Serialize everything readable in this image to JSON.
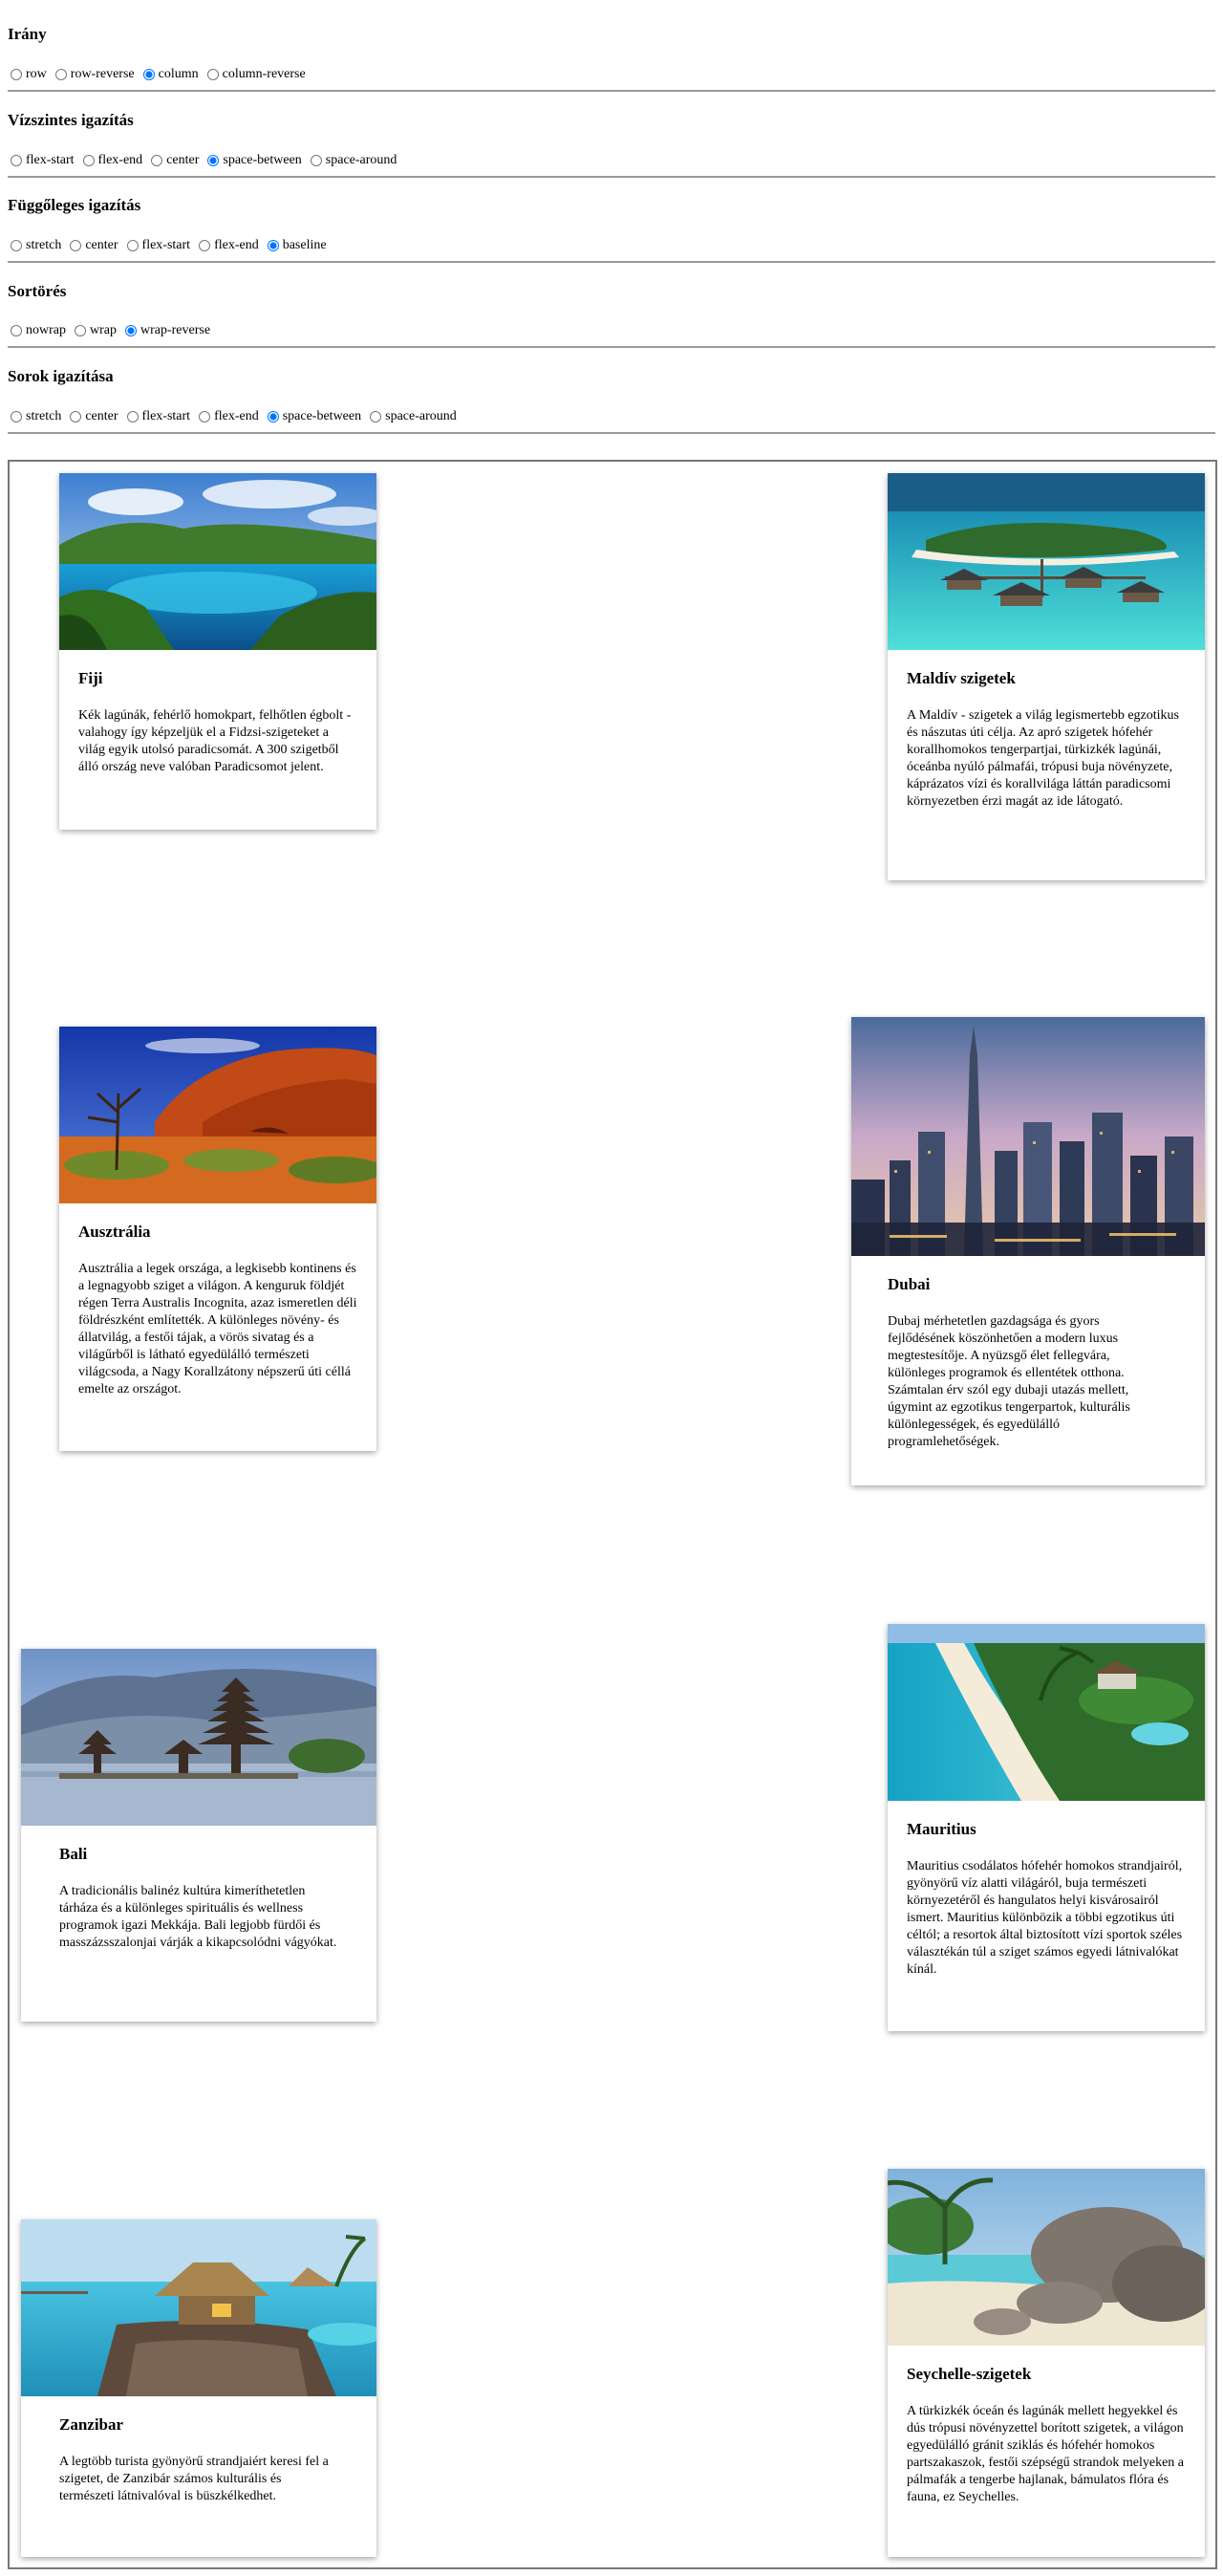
{
  "controls": {
    "direction": {
      "title": "Irány",
      "options": [
        "row",
        "row-reverse",
        "column",
        "column-reverse"
      ],
      "selected": "column"
    },
    "justify": {
      "title": "Vízszintes igazítás",
      "options": [
        "flex-start",
        "flex-end",
        "center",
        "space-between",
        "space-around"
      ],
      "selected": "space-between"
    },
    "align_items": {
      "title": "Függőleges igazítás",
      "options": [
        "stretch",
        "center",
        "flex-start",
        "flex-end",
        "baseline"
      ],
      "selected": "baseline"
    },
    "wrap": {
      "title": "Sortörés",
      "options": [
        "nowrap",
        "wrap",
        "wrap-reverse"
      ],
      "selected": "wrap-reverse"
    },
    "align_content": {
      "title": "Sorok igazítása",
      "options": [
        "stretch",
        "center",
        "flex-start",
        "flex-end",
        "space-between",
        "space-around"
      ],
      "selected": "space-between"
    }
  },
  "cards": [
    {
      "title": "Fiji",
      "text": "Kék lagúnák, fehérlő homokpart, felhőtlen égbolt - valahogy így képzeljük el a Fidzsi-szigeteket a világ egyik utolsó paradicsomát. A 300 szigetből álló ország neve valóban Paradicsomot jelent."
    },
    {
      "title": "Maldív szigetek",
      "text": "A Maldív - szigetek a világ legismertebb egzotikus és nászutas úti célja. Az apró szigetek hófehér korallhomokos tengerpartjai, türkizkék lagúnái, óceánba nyúló pálmafái, trópusi buja növényzete, káprázatos vízi és korallvilága láttán paradicsomi környezetben érzi magát az ide látogató."
    },
    {
      "title": "Ausztrália",
      "text": "Ausztrália a legek országa, a legkisebb kontinens és a legnagyobb sziget a világon. A kenguruk földjét régen Terra Australis Incognita, azaz ismeretlen déli földrészként említették. A különleges növény- és állatvilág, a festői tájak, a vörös sivatag és a világűrből is látható egyedülálló természeti világcsoda, a Nagy Korallzátony népszerű úti céllá emelte az országot."
    },
    {
      "title": "Dubai",
      "text": "Dubaj mérhetetlen gazdagsága és gyors fejlődésének köszönhetően a modern luxus megtestesítője. A nyüzsgő élet fellegvára, különleges programok és ellentétek otthona. Számtalan érv szól egy dubaji utazás mellett, úgymint az egzotikus tengerpartok, kulturális különlegességek, és egyedülálló programlehetőségek."
    },
    {
      "title": "Bali",
      "text": "A tradicionális balinéz kultúra kimeríthetetlen tárháza és a különleges spirituális és wellness programok igazi Mekkája. Bali legjobb fürdői és masszázsszalonjai várják a kikapcsolódni vágyókat."
    },
    {
      "title": "Mauritius",
      "text": "Mauritius csodálatos hófehér homokos strandjairól, gyönyörű víz alatti világáról, buja természeti környezetéről és hangulatos helyi kisvárosairól ismert. Mauritius különbözik a többi egzotikus úti céltól; a resortok által biztosított vízi sportok széles választékán túl a sziget számos egyedi látnivalókat kínál."
    },
    {
      "title": "Zanzibar",
      "text": "A legtöbb turista gyönyörű strandjaiért keresi fel a szigetet, de Zanzibár számos kulturális és természeti látnivalóval is büszkélkedhet."
    },
    {
      "title": "Seychelle-szigetek",
      "text": "A türkizkék óceán és lagúnák mellett hegyekkel és dús trópusi növényzettel borított szigetek, a világon egyedülálló gránit sziklás és hófehér homokos partszakaszok, festői szépségű strandok melyeken a pálmafák a tengerbe hajlanak, bámulatos flóra és fauna, ez Seychelles."
    }
  ]
}
